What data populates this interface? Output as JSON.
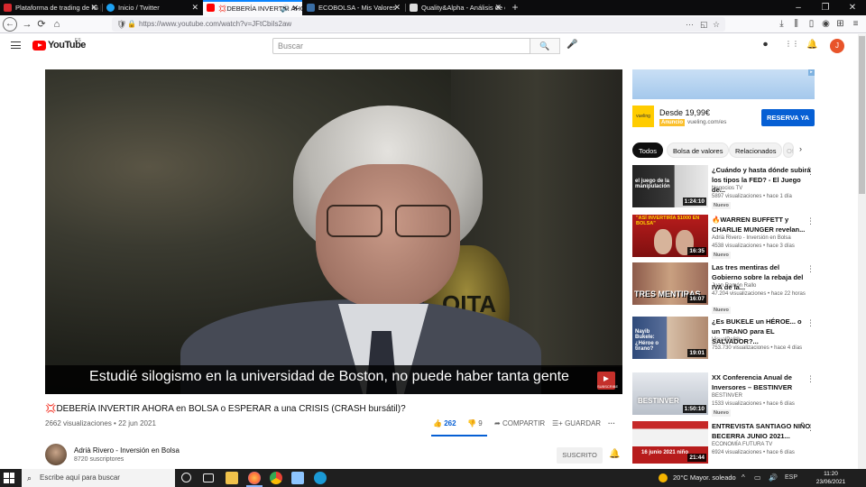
{
  "browser": {
    "tabs": [
      {
        "label": "Plataforma de trading de IG | C",
        "favicon_color": "#d6282e",
        "favicon_text": "IG"
      },
      {
        "label": "Inicio / Twitter",
        "favicon_color": "#1da1f2",
        "favicon_text": ""
      },
      {
        "label": "💢DEBERÍA INVERTIR AHORA",
        "favicon_color": "#ff0000",
        "favicon_text": ""
      },
      {
        "label": "ECOBOLSA - Mis Valores",
        "favicon_color": "#3a6ea5",
        "favicon_text": ""
      },
      {
        "label": "Quality&Alpha - Análisis de em",
        "favicon_color": "#dddddd",
        "favicon_text": "Q"
      }
    ],
    "new_tab": "+",
    "window_controls": {
      "minimize": "–",
      "maximize": "❐",
      "close": "✕"
    },
    "url": "https://www.youtube.com/watch?v=JFtCbiIs2aw",
    "nav": {
      "back": "←",
      "forward": "→",
      "reload": "⟳",
      "home": "⌂"
    },
    "url_icons": {
      "shield": "🛡",
      "lock": "🔒",
      "more": "···",
      "pocket": "◱",
      "star": "☆"
    },
    "toolbar_icons": {
      "download": "⤓",
      "library": "⫼",
      "sidebar": "▯",
      "account": "◉",
      "extensions": "⊞",
      "menu": "≡"
    }
  },
  "youtube": {
    "logo_text": "YouTube",
    "country": "ES",
    "search_placeholder": "Buscar",
    "search_icon": "🔍",
    "mic_icon": "🎤",
    "header_icons": {
      "create": "⏺",
      "apps": "⋮⋮",
      "notifications": "🔔"
    },
    "avatar_letter": "J"
  },
  "video": {
    "subtitle": "Estudié silogismo en la universidad de Boston, no puede haber tanta gente",
    "watermark_label": "SUBSCRIBE",
    "frame_emblem_text": "OITA",
    "title_icon": "💢",
    "title": "DEBERÍA INVERTIR AHORA en BOLSA o ESPERAR a una CRISIS (CRASH bursátil)?",
    "views": "2662 visualizaciones • 22 jun 2021",
    "likes": "262",
    "dislikes": "9",
    "share": "COMPARTIR",
    "save": "GUARDAR",
    "more": "···",
    "like_icon": "👍",
    "dislike_icon": "👎",
    "share_icon": "➦",
    "save_icon": "☰+",
    "channel_name": "Adrià Rivero - Inversión en Bolsa",
    "channel_subs": "8720 suscriptores",
    "subscribe_label": "SUSCRITO",
    "bell_icon": "🔔"
  },
  "ad": {
    "banner_mark": "▸",
    "logo_text": "vueling",
    "price": "Desde 19,99€",
    "tag": "Anuncio",
    "domain": "vueling.com/es",
    "cta": "RESERVA YA"
  },
  "chips": [
    "Todos",
    "Bolsa de valores",
    "Relacionados",
    "Of"
  ],
  "chip_next": "›",
  "recommendations": [
    {
      "title": "¿Cuándo y hasta dónde subirá los tipos la FED? - El Juego de...",
      "channel": "Negocios TV",
      "meta": "5897 visualizaciones • hace 1 día",
      "badge": "Nuevo",
      "duration": "1:24:10",
      "thumb_caption": "el juego de la manipulación",
      "thumb_bg": "#2b2b2b",
      "cap_color": "#ffffff"
    },
    {
      "title": "🔥WARREN BUFFETT y CHARLIE MUNGER revelan...",
      "channel": "Adrià Rivero - Inversión en Bolsa",
      "meta": "4538 visualizaciones • hace 3 días",
      "badge": "Nuevo",
      "duration": "16:35",
      "thumb_caption": "\"ASÍ INVERTIRÍA $1000 EN BOLSA\"",
      "thumb_bg": "#c0261f",
      "cap_color": "#ffd400"
    },
    {
      "title": "Las tres mentiras del Gobierno sobre la rebaja del IVA de la...",
      "channel": "Juan Ramón Rallo",
      "meta": "47.204 visualizaciones • hace 22 horas",
      "badge": "Nuevo",
      "duration": "16:07",
      "thumb_caption": "TRES MENTIRAS",
      "thumb_bg": "#7a4a3c",
      "cap_color": "#ffffff"
    },
    {
      "title": "¿Es BUKELE un HÉROE... o un TIRANO para EL SALVADOR?...",
      "channel": "VisualPolitik",
      "meta": "753.730 visualizaciones • hace 4 días",
      "badge": "",
      "duration": "19:01",
      "thumb_caption": "Nayib Bukele: ¿Héroe o tirano?",
      "thumb_bg": "#3c5a8a",
      "cap_color": "#ffffff"
    },
    {
      "title": "XX Conferencia Anual de Inversores – BESTINVER",
      "channel": "BESTINVER",
      "meta": "1533 visualizaciones • hace 6 días",
      "badge": "Nuevo",
      "duration": "1:50:10",
      "thumb_caption": "BESTINVER",
      "thumb_bg": "#c9ced6",
      "cap_color": "#ffffff"
    },
    {
      "title": "ENTREVISTA SANTIAGO NIÑO BECERRA JUNIO 2021...",
      "channel": "ECONOMÍA FUTURA TV",
      "meta": "6924 visualizaciones • hace 6 días",
      "badge": "",
      "duration": "21:44",
      "thumb_caption": "16 junio 2021 niño",
      "thumb_bg": "#b3262a",
      "cap_color": "#ffffff"
    }
  ],
  "taskbar": {
    "search_placeholder": "Escribe aquí para buscar",
    "search_icon": "⌕",
    "weather": "20°C  Mayor. soleado",
    "tray_icons": [
      "^",
      "▭",
      "🔊",
      "ESP"
    ],
    "time": "11:20",
    "date": "23/06/2021",
    "apps": [
      {
        "name": "cortana",
        "color": "#1f1f1f"
      },
      {
        "name": "task-view",
        "color": "#1f1f1f"
      },
      {
        "name": "file-explorer",
        "color": "#f0c24b"
      },
      {
        "name": "firefox",
        "color": "#ff7139"
      },
      {
        "name": "chrome",
        "color": "#4285f4"
      },
      {
        "name": "notepad",
        "color": "#8ec5ff"
      },
      {
        "name": "photos",
        "color": "#f3d44c"
      },
      {
        "name": "edge",
        "color": "#1b9ad6"
      }
    ]
  }
}
